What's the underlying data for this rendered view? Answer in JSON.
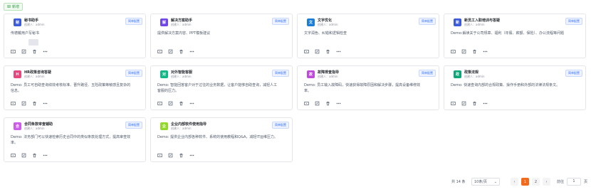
{
  "toolbar": {
    "add_label": "新增"
  },
  "cards": [
    {
      "name": "秘书助手",
      "creator": "创建人：admin",
      "tag": "简单配置",
      "desc": "传德戴用户写秘书",
      "avatar": "秘",
      "color": "#3b5bdb"
    },
    {
      "name": "解决方案助手",
      "creator": "创建人：admin",
      "tag": "简单配置",
      "desc": "提供解决方案内容、PPT模板建议",
      "avatar": "解",
      "color": "#7048e8"
    },
    {
      "name": "文字优化",
      "creator": "创建人：admin",
      "tag": "简单配置",
      "desc": "文字润色、纠错和逻辑检查",
      "avatar": "文",
      "color": "#1c7ed6"
    },
    {
      "name": "新员工入职培训与答疑",
      "creator": "创建人：admin",
      "tag": "简单配置",
      "desc": "Demo:解读关于公司规章、福利（年假、薪额、保险）、办公流程等问题",
      "avatar": "新",
      "color": "#3b5bdb"
    },
    {
      "name": "HR政策咨询答疑",
      "creator": "创建人：admin",
      "tag": "简单配置",
      "desc": "Demo: 员工可自助查询绩效考核标准、晋升路径、五险政策等敏感且复杂的信息。",
      "avatar": "H",
      "color": "#e64980"
    },
    {
      "name": "对外智能客服",
      "creator": "创建人：admin",
      "tag": "简单配置",
      "desc": "Demo: 智能回答客户对于过往的业务数据，让客户能够自助查询，减轻人工客服的压力。",
      "avatar": "对",
      "color": "#12b886"
    },
    {
      "name": "故障排查指导",
      "creator": "创建人：admin",
      "tag": "简单配置",
      "desc": "Demo: 员工输入故障码，快速获得故障原因和解决步骤，提高设备维修效率。",
      "avatar": "故",
      "color": "#be4bdb"
    },
    {
      "name": "政策法规",
      "creator": "创建人：admin",
      "tag": "简单配置",
      "desc": "Demo: 快速查询内部的合规政策、操作手册和外部的法律法规条文。",
      "avatar": "政",
      "color": "#0ca678"
    },
    {
      "name": "合同条款审查辅助",
      "creator": "创建人：admin",
      "tag": "简单配置",
      "desc": "Demo: 法务部门可以快速检索历史合同中的类似条款处理方式，提高审查效率。",
      "avatar": "合",
      "color": "#cc5de8"
    },
    {
      "name": "企业内部软件使用指导",
      "creator": "创建人：admin",
      "tag": "简单配置",
      "desc": "Demo: 提供企业内部各种软件、系统的使用教程和Q&A，减轻IT运维压力。",
      "avatar": "企",
      "color": "#94d82d"
    }
  ],
  "pagination": {
    "total": "共 14 条",
    "page_size": "10条/页",
    "pages": [
      "1",
      "2"
    ],
    "goto_label": "前往",
    "goto_value": "1",
    "page_unit": "页",
    "prev": "‹",
    "next": "›"
  }
}
